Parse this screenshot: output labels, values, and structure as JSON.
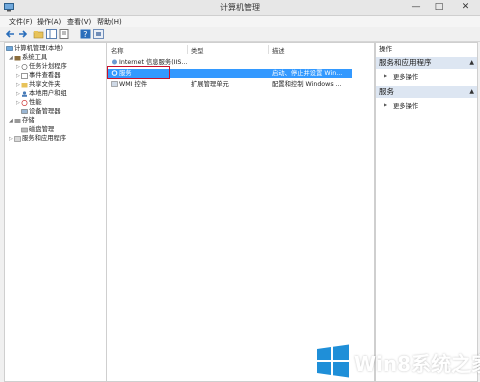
{
  "window": {
    "title": "计算机管理"
  },
  "menu": {
    "file": "文件(F)",
    "action": "操作(A)",
    "view": "查看(V)",
    "help": "帮助(H)"
  },
  "tree": {
    "root": "计算机管理(本地)",
    "system_tools": "系统工具",
    "task_scheduler": "任务计划程序",
    "event_viewer": "事件查看器",
    "shared_folders": "共享文件夹",
    "local_users": "本地用户和组",
    "performance": "性能",
    "device_manager": "设备管理器",
    "storage": "存储",
    "disk_management": "磁盘管理",
    "services_apps": "服务和应用程序"
  },
  "list": {
    "columns": [
      "名称",
      "类型",
      "描述"
    ],
    "rows": [
      {
        "name": "Internet 信息服务(IIS...",
        "type": "",
        "desc": ""
      },
      {
        "name": "服务",
        "type": "",
        "desc": "启动、停止并设置 Win..."
      },
      {
        "name": "WMI 控件",
        "type": "扩展管理单元",
        "desc": "配置和控制 Windows ..."
      }
    ]
  },
  "actions": {
    "header": "操作",
    "section1": "服务和应用程序",
    "more1": "更多操作",
    "section2": "服务",
    "more2": "更多操作"
  },
  "watermark": {
    "text": "Win8系统之家"
  },
  "colors": {
    "selection": "#3399ff",
    "highlight_box": "#c8102e",
    "logo_blue": "#1f8fd8",
    "section_bg": "#dde6f2"
  },
  "icons": [
    "app-icon",
    "back-icon",
    "forward-icon",
    "up-folder-icon",
    "show-tree-icon",
    "properties-icon",
    "help-icon",
    "refresh-icon",
    "computer-icon",
    "toolbox-icon",
    "clock-icon",
    "event-icon",
    "share-icon",
    "users-icon",
    "performance-icon",
    "device-icon",
    "storage-icon",
    "disk-icon",
    "services-icon",
    "iis-icon",
    "gear-icon",
    "wmi-icon",
    "windows-logo-icon"
  ]
}
